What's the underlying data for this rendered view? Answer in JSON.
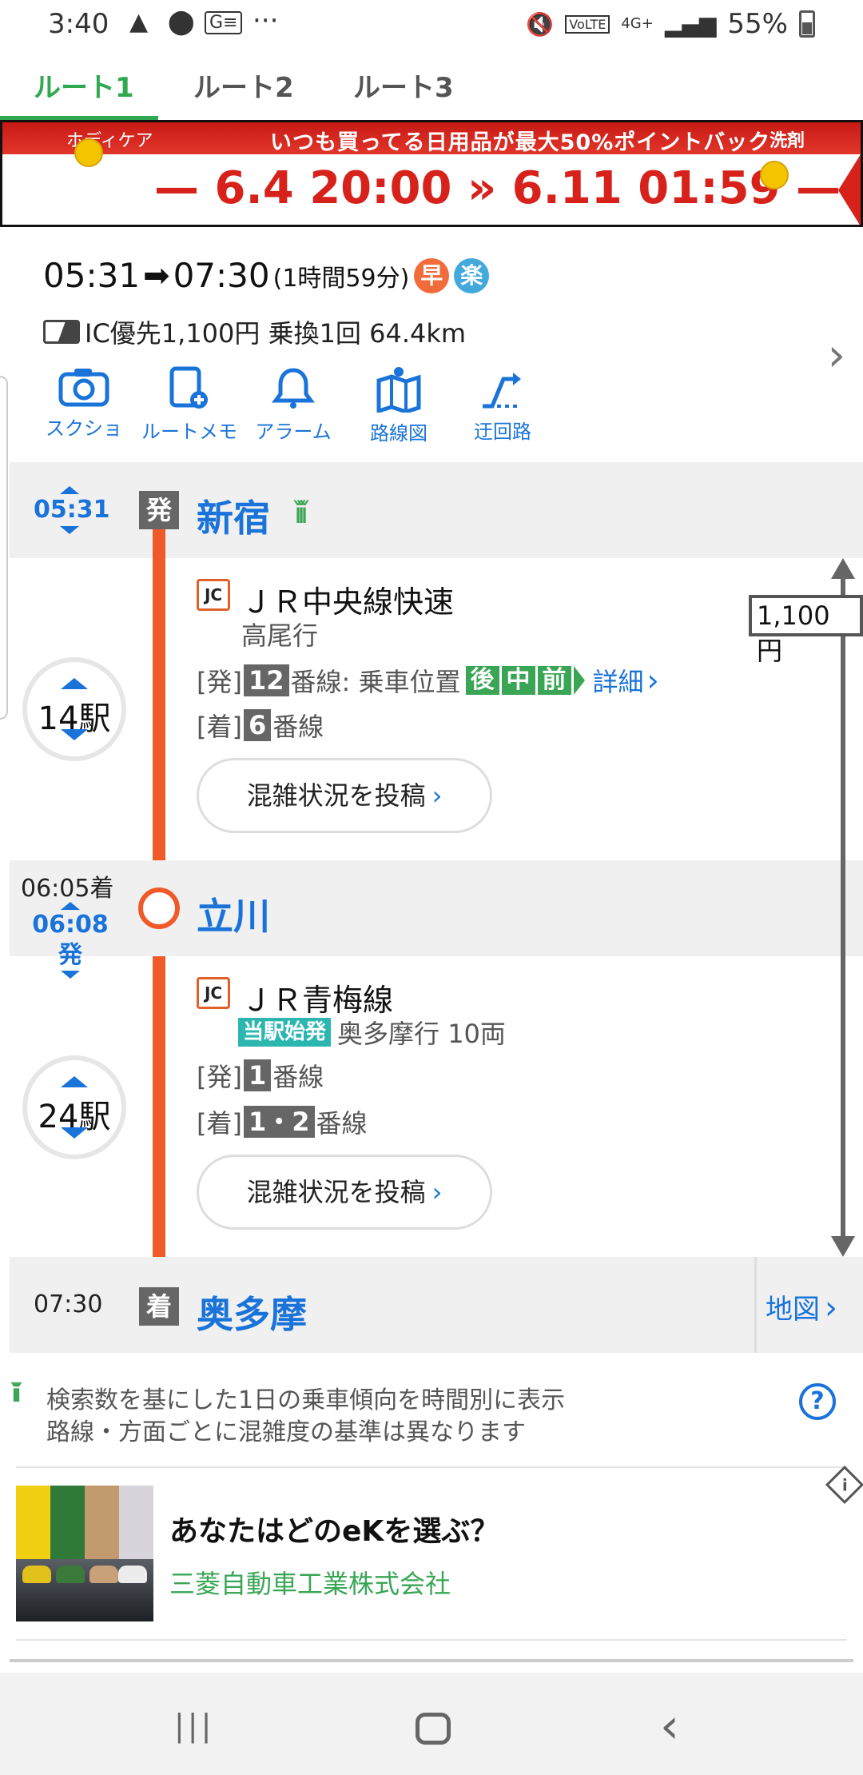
{
  "status_bar": {
    "time": "3:40",
    "battery": "55%",
    "network": "4G+",
    "volte": "VoLTE"
  },
  "tabs": [
    {
      "label": "ルート1",
      "active": true
    },
    {
      "label": "ルート2",
      "active": false
    },
    {
      "label": "ルート3",
      "active": false
    }
  ],
  "banner": {
    "headline": "いつも買ってる日用品が最大50%ポイントバック",
    "date_range": "— 6.4 20:00 » 6.11 01:59 —",
    "brand_left": "ホディケア",
    "brand_right": "洗剤"
  },
  "summary": {
    "depart": "05:31",
    "arrive": "07:30",
    "duration": "(1時間59分)",
    "badge_fast": "早",
    "badge_easy": "楽",
    "fare_info": "IC優先1,100円 乗換1回 64.4km"
  },
  "actions": [
    {
      "label": "スクショ",
      "icon": "camera-icon"
    },
    {
      "label": "ルートメモ",
      "icon": "route-memo-icon"
    },
    {
      "label": "アラーム",
      "icon": "bell-icon"
    },
    {
      "label": "路線図",
      "icon": "map-icon"
    },
    {
      "label": "迂回路",
      "icon": "detour-icon"
    }
  ],
  "route": {
    "origin": {
      "time": "05:31",
      "badge": "発",
      "name": "新宿"
    },
    "leg1": {
      "stops": "14駅",
      "line_icon": "JC",
      "line": "ＪＲ中央線快速",
      "bound": "高尾行",
      "dep_label": "[発]",
      "dep_platform": "12",
      "platform_suffix": "番線",
      "position_label": ": 乗車位置",
      "positions": [
        "後",
        "中",
        "前"
      ],
      "detail": "詳細",
      "arr_label": "[着]",
      "arr_platform": "6",
      "post_button": "混雑状況を投稿"
    },
    "transfer": {
      "arr_time": "06:05着",
      "dep_time": "06:08発",
      "name": "立川"
    },
    "leg2": {
      "stops": "24駅",
      "line_icon": "JC",
      "line": "ＪＲ青梅線",
      "start_tag": "当駅始発",
      "bound": "奥多摩行 10両",
      "dep_label": "[発]",
      "dep_platform": "1",
      "platform_suffix": "番線",
      "arr_label": "[着]",
      "arr_platform": "1・2",
      "post_button": "混雑状況を投稿"
    },
    "destination": {
      "time": "07:30",
      "badge": "着",
      "name": "奥多摩",
      "map_link": "地図"
    },
    "fare": "1,100円"
  },
  "notes": {
    "line1": "検索数を基にした1日の乗車傾向を時間別に表示",
    "line2": "路線・方面ごとに混雑度の基準は異なります",
    "help": "?"
  },
  "ad": {
    "title": "あなたはどのeKを選ぶ？",
    "sponsor": "三菱自動車工業株式会社"
  },
  "colors": {
    "accent_green": "#2fa84f",
    "link_blue": "#1a73d9",
    "route_line": "#f05a28"
  }
}
